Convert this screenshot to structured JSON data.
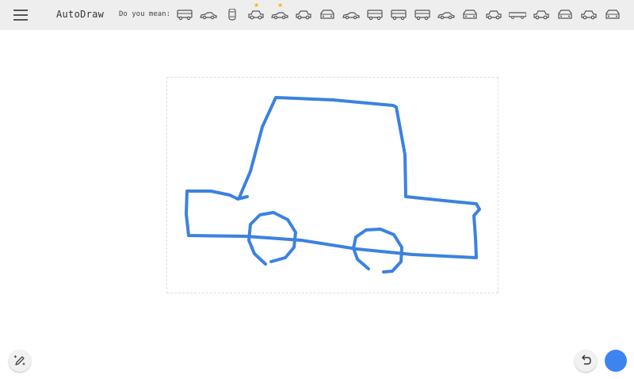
{
  "app": {
    "title": "AutoDraw",
    "menu_icon": "hamburger-menu-icon"
  },
  "suggestions": {
    "label": "Do you mean:",
    "items": [
      {
        "icon": "police-car-icon",
        "starred": false
      },
      {
        "icon": "race-car-icon",
        "starred": false
      },
      {
        "icon": "car-top-view-icon",
        "starred": false
      },
      {
        "icon": "beetle-car-icon",
        "starred": true
      },
      {
        "icon": "sports-car-icon",
        "starred": true
      },
      {
        "icon": "sedan-icon",
        "starred": false
      },
      {
        "icon": "car-front-icon",
        "starred": false
      },
      {
        "icon": "coupe-icon",
        "starred": false
      },
      {
        "icon": "bus-icon",
        "starred": false
      },
      {
        "icon": "tram-icon",
        "starred": false
      },
      {
        "icon": "fire-truck-icon",
        "starred": false
      },
      {
        "icon": "roadster-icon",
        "starred": false
      },
      {
        "icon": "taxi-icon",
        "starred": false
      },
      {
        "icon": "hatchback-icon",
        "starred": false
      },
      {
        "icon": "limousine-icon",
        "starred": false
      },
      {
        "icon": "tow-truck-icon",
        "starred": false
      },
      {
        "icon": "ladder-truck-icon",
        "starred": false
      },
      {
        "icon": "van-icon",
        "starred": false
      },
      {
        "icon": "school-bus-icon",
        "starred": false
      }
    ]
  },
  "canvas": {
    "stroke_color": "#3b82e0"
  },
  "tools": {
    "autodraw_icon": "autodraw-pen-icon",
    "undo_icon": "undo-icon",
    "current_color": "#3d84f0"
  },
  "colors": {
    "toolbar_bg": "#eeeeee",
    "star": "#f5b400",
    "icon": "#555555"
  }
}
